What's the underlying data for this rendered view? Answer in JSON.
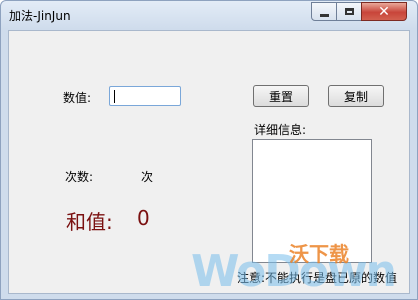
{
  "window": {
    "title": "加法-JinJun",
    "controls": {
      "minimize": "minimize-icon",
      "maximize": "maximize-icon",
      "close": "close-icon"
    }
  },
  "form": {
    "value_label": "数值:",
    "value_input": "",
    "reset_button": "重置",
    "copy_button": "复制",
    "details_label": "详细信息:",
    "details_text": "",
    "count_label": "次数:",
    "count_unit": "次",
    "sum_label": "和值:",
    "sum_value": "0",
    "note": "注意:不能执行是盘已原的数值"
  },
  "watermark": {
    "brand_text": "WoDown",
    "brand_cn": "沃下载"
  }
}
